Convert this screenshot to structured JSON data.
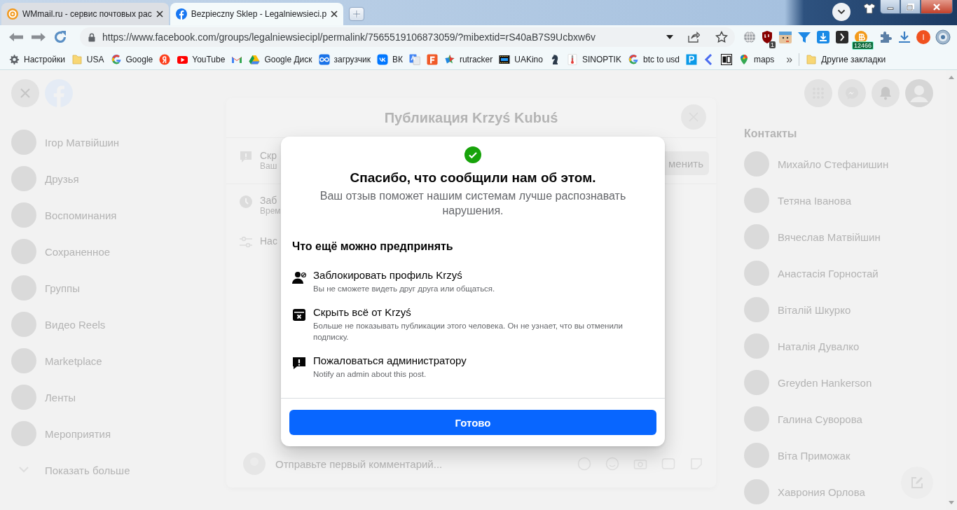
{
  "browser": {
    "tabs": [
      {
        "title": "WMmail.ru - сервис почтовых рас",
        "selected": false
      },
      {
        "title": "Bezpieczny Sklep - Legalniewsieci.p",
        "selected": true
      }
    ],
    "url": "https://www.facebook.com/groups/legalniewsiecipl/permalink/7565519106873059/?mibextid=rS40aB7S9Ucbxw6v",
    "extension_badges": [
      "1",
      "12466"
    ],
    "profile_initial": "I",
    "bookmarks": [
      {
        "kind": "link",
        "label": "Настройки"
      },
      {
        "kind": "link",
        "label": "USA"
      },
      {
        "kind": "link",
        "label": "Google"
      },
      {
        "kind": "icon"
      },
      {
        "kind": "link",
        "label": "YouTube"
      },
      {
        "kind": "icon"
      },
      {
        "kind": "link",
        "label": "Google Диск"
      },
      {
        "kind": "link",
        "label": "загрузчик"
      },
      {
        "kind": "link",
        "label": "ВК"
      },
      {
        "kind": "icon"
      },
      {
        "kind": "icon"
      },
      {
        "kind": "link",
        "label": "rutracker"
      },
      {
        "kind": "link",
        "label": "UAKino"
      },
      {
        "kind": "icon"
      },
      {
        "kind": "link",
        "label": "SINOPTIK"
      },
      {
        "kind": "link",
        "label": "btc to usd"
      },
      {
        "kind": "icon"
      },
      {
        "kind": "icon"
      },
      {
        "kind": "icon"
      },
      {
        "kind": "link",
        "label": "maps"
      }
    ],
    "more_bookmarks": "»",
    "other_bookmarks": "Другие закладки"
  },
  "page": {
    "sidebar": [
      {
        "label": "Ігор Матвійшин"
      },
      {
        "label": "Друзья"
      },
      {
        "label": "Воспоминания"
      },
      {
        "label": "Сохраненное"
      },
      {
        "label": "Группы"
      },
      {
        "label": "Видео Reels"
      },
      {
        "label": "Marketplace"
      },
      {
        "label": "Ленты"
      },
      {
        "label": "Мероприятия"
      }
    ],
    "show_more": "Показать больше",
    "post_dialog": {
      "title": "Публикация Krzyś Kubuś",
      "rows": [
        {
          "title": "Скр",
          "subtitle": "Ваш"
        },
        {
          "title": "Заб",
          "subtitle": "Врем"
        },
        {
          "title": "Нас"
        }
      ],
      "action": "менить",
      "comment_placeholder": "Отправьте первый комментарий..."
    },
    "contacts": {
      "title": "Контакты",
      "items": [
        {
          "name": "Михайло Стефанишин"
        },
        {
          "name": "Тетяна Іванова"
        },
        {
          "name": "Вячеслав Матвійшин"
        },
        {
          "name": "Анастасія Горностай"
        },
        {
          "name": "Віталій Шкурко"
        },
        {
          "name": "Наталія Дувалко"
        },
        {
          "name": "Greyden Hankerson"
        },
        {
          "name": "Галина Суворова"
        },
        {
          "name": "Віта Приможак"
        },
        {
          "name": "Хаврония Орлова"
        }
      ]
    }
  },
  "modal": {
    "title": "Спасибо, что сообщили нам об этом.",
    "subtitle": "Ваш отзыв поможет нашим системам лучше распознавать нарушения.",
    "section_title": "Что ещё можно предпринять",
    "actions": [
      {
        "title": "Заблокировать профиль Krzyś",
        "subtitle": "Вы не сможете видеть друг друга или общаться."
      },
      {
        "title": "Скрыть всё от Krzyś",
        "subtitle": "Больше не показывать публикации этого человека. Он не узнает, что вы отменили подписку."
      },
      {
        "title": "Пожаловаться администратору",
        "subtitle": "Notify an admin about this post."
      }
    ],
    "button": "Готово"
  }
}
